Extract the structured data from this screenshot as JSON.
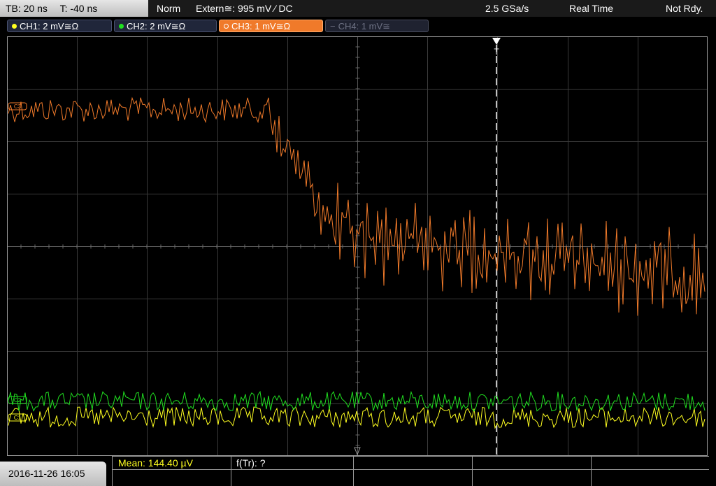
{
  "topbar": {
    "timebase": "TB: 20 ns",
    "trigger_offset": "T: -40 ns",
    "mode": "Norm",
    "trigger_source": "Extern≅: 995 mV ⁄ DC",
    "sample_rate": "2.5 GSa/s",
    "acq_mode": "Real Time",
    "state": "Not Rdy."
  },
  "channels": [
    {
      "label": "CH1: 2 mV≅Ω",
      "color": "#ffff20",
      "active": true
    },
    {
      "label": "CH2: 2 mV≅Ω",
      "color": "#20e020",
      "active": true
    },
    {
      "label": "CH3: 1 mV≅Ω",
      "color": "#f07a2a",
      "active": true,
      "selected": true
    },
    {
      "label": "CH4: 1 mV≅",
      "color": "#6f7385",
      "active": false
    }
  ],
  "markers": {
    "ch3": "C3",
    "ch2": "C2",
    "ch1": "C1",
    "trigger": "T"
  },
  "bottom": {
    "datetime": "2016-11-26 16:05",
    "measurement": "Mean: 144.40 µV",
    "function": "f(Tr): ?"
  },
  "colors": {
    "ch1": "#ffff20",
    "ch2": "#20e020",
    "ch3": "#f07a2a",
    "grid": "#4a4a4a",
    "border": "#9a9a9a"
  }
}
